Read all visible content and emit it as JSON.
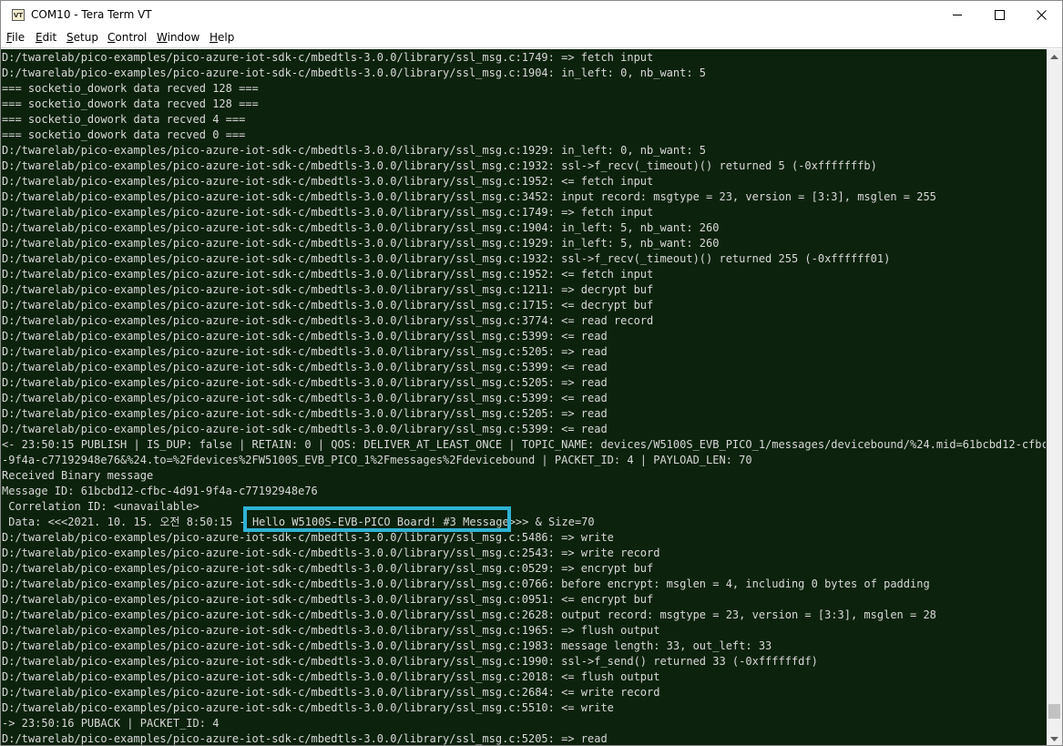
{
  "window": {
    "title": "COM10 - Tera Term VT",
    "app_icon_text": "VT"
  },
  "menu": [
    {
      "accel": "F",
      "rest": "ile"
    },
    {
      "accel": "E",
      "rest": "dit"
    },
    {
      "accel": "S",
      "rest": "etup"
    },
    {
      "accel": "C",
      "rest": "ontrol"
    },
    {
      "accel": "W",
      "rest": "indow"
    },
    {
      "accel": "H",
      "rest": "elp"
    }
  ],
  "terminal": {
    "lines": [
      "D:/twarelab/pico-examples/pico-azure-iot-sdk-c/mbedtls-3.0.0/library/ssl_msg.c:1749: => fetch input",
      "D:/twarelab/pico-examples/pico-azure-iot-sdk-c/mbedtls-3.0.0/library/ssl_msg.c:1904: in_left: 0, nb_want: 5",
      "=== socketio_dowork data recved 128 ===",
      "=== socketio_dowork data recved 128 ===",
      "=== socketio_dowork data recved 4 ===",
      "=== socketio_dowork data recved 0 ===",
      "D:/twarelab/pico-examples/pico-azure-iot-sdk-c/mbedtls-3.0.0/library/ssl_msg.c:1929: in_left: 0, nb_want: 5",
      "D:/twarelab/pico-examples/pico-azure-iot-sdk-c/mbedtls-3.0.0/library/ssl_msg.c:1932: ssl->f_recv(_timeout)() returned 5 (-0xfffffffb)",
      "D:/twarelab/pico-examples/pico-azure-iot-sdk-c/mbedtls-3.0.0/library/ssl_msg.c:1952: <= fetch input",
      "D:/twarelab/pico-examples/pico-azure-iot-sdk-c/mbedtls-3.0.0/library/ssl_msg.c:3452: input record: msgtype = 23, version = [3:3], msglen = 255",
      "D:/twarelab/pico-examples/pico-azure-iot-sdk-c/mbedtls-3.0.0/library/ssl_msg.c:1749: => fetch input",
      "D:/twarelab/pico-examples/pico-azure-iot-sdk-c/mbedtls-3.0.0/library/ssl_msg.c:1904: in_left: 5, nb_want: 260",
      "D:/twarelab/pico-examples/pico-azure-iot-sdk-c/mbedtls-3.0.0/library/ssl_msg.c:1929: in_left: 5, nb_want: 260",
      "D:/twarelab/pico-examples/pico-azure-iot-sdk-c/mbedtls-3.0.0/library/ssl_msg.c:1932: ssl->f_recv(_timeout)() returned 255 (-0xffffff01)",
      "D:/twarelab/pico-examples/pico-azure-iot-sdk-c/mbedtls-3.0.0/library/ssl_msg.c:1952: <= fetch input",
      "D:/twarelab/pico-examples/pico-azure-iot-sdk-c/mbedtls-3.0.0/library/ssl_msg.c:1211: => decrypt buf",
      "D:/twarelab/pico-examples/pico-azure-iot-sdk-c/mbedtls-3.0.0/library/ssl_msg.c:1715: <= decrypt buf",
      "D:/twarelab/pico-examples/pico-azure-iot-sdk-c/mbedtls-3.0.0/library/ssl_msg.c:3774: <= read record",
      "D:/twarelab/pico-examples/pico-azure-iot-sdk-c/mbedtls-3.0.0/library/ssl_msg.c:5399: <= read",
      "D:/twarelab/pico-examples/pico-azure-iot-sdk-c/mbedtls-3.0.0/library/ssl_msg.c:5205: => read",
      "D:/twarelab/pico-examples/pico-azure-iot-sdk-c/mbedtls-3.0.0/library/ssl_msg.c:5399: <= read",
      "D:/twarelab/pico-examples/pico-azure-iot-sdk-c/mbedtls-3.0.0/library/ssl_msg.c:5205: => read",
      "D:/twarelab/pico-examples/pico-azure-iot-sdk-c/mbedtls-3.0.0/library/ssl_msg.c:5399: <= read",
      "D:/twarelab/pico-examples/pico-azure-iot-sdk-c/mbedtls-3.0.0/library/ssl_msg.c:5205: => read",
      "D:/twarelab/pico-examples/pico-azure-iot-sdk-c/mbedtls-3.0.0/library/ssl_msg.c:5399: <= read",
      "<- 23:50:15 PUBLISH | IS_DUP: false | RETAIN: 0 | QOS: DELIVER_AT_LEAST_ONCE | TOPIC_NAME: devices/W5100S_EVB_PICO_1/messages/devicebound/%24.mid=61bcbd12-cfbc-4d91",
      "-9f4a-c77192948e76&%24.to=%2Fdevices%2FW5100S_EVB_PICO_1%2Fmessages%2Fdevicebound | PACKET_ID: 4 | PAYLOAD_LEN: 70",
      "Received Binary message",
      "Message ID: 61bcbd12-cfbc-4d91-9f4a-c77192948e76",
      " Correlation ID: <unavailable>",
      " Data: <<<2021. 10. 15. 오전 8:50:15 - Hello W5100S-EVB-PICO Board! #3 Message>>> & Size=70",
      "D:/twarelab/pico-examples/pico-azure-iot-sdk-c/mbedtls-3.0.0/library/ssl_msg.c:5486: => write",
      "D:/twarelab/pico-examples/pico-azure-iot-sdk-c/mbedtls-3.0.0/library/ssl_msg.c:2543: => write record",
      "D:/twarelab/pico-examples/pico-azure-iot-sdk-c/mbedtls-3.0.0/library/ssl_msg.c:0529: => encrypt buf",
      "D:/twarelab/pico-examples/pico-azure-iot-sdk-c/mbedtls-3.0.0/library/ssl_msg.c:0766: before encrypt: msglen = 4, including 0 bytes of padding",
      "D:/twarelab/pico-examples/pico-azure-iot-sdk-c/mbedtls-3.0.0/library/ssl_msg.c:0951: <= encrypt buf",
      "D:/twarelab/pico-examples/pico-azure-iot-sdk-c/mbedtls-3.0.0/library/ssl_msg.c:2628: output record: msgtype = 23, version = [3:3], msglen = 28",
      "D:/twarelab/pico-examples/pico-azure-iot-sdk-c/mbedtls-3.0.0/library/ssl_msg.c:1965: => flush output",
      "D:/twarelab/pico-examples/pico-azure-iot-sdk-c/mbedtls-3.0.0/library/ssl_msg.c:1983: message length: 33, out_left: 33",
      "D:/twarelab/pico-examples/pico-azure-iot-sdk-c/mbedtls-3.0.0/library/ssl_msg.c:1990: ssl->f_send() returned 33 (-0xffffffdf)",
      "D:/twarelab/pico-examples/pico-azure-iot-sdk-c/mbedtls-3.0.0/library/ssl_msg.c:2018: <= flush output",
      "D:/twarelab/pico-examples/pico-azure-iot-sdk-c/mbedtls-3.0.0/library/ssl_msg.c:2684: <= write record",
      "D:/twarelab/pico-examples/pico-azure-iot-sdk-c/mbedtls-3.0.0/library/ssl_msg.c:5510: <= write",
      "-> 23:50:16 PUBACK | PACKET_ID: 4",
      "D:/twarelab/pico-examples/pico-azure-iot-sdk-c/mbedtls-3.0.0/library/ssl_msg.c:5205: => read"
    ]
  },
  "colors": {
    "terminal_bg": "#0c220c",
    "terminal_fg": "#d8d8d8",
    "highlight_border": "#2fb3d4"
  },
  "icons": {
    "minimize": "minimize-icon",
    "maximize": "maximize-icon",
    "close": "close-icon",
    "scroll_up": "scroll-up-arrow-icon",
    "scroll_down": "scroll-down-arrow-icon"
  }
}
